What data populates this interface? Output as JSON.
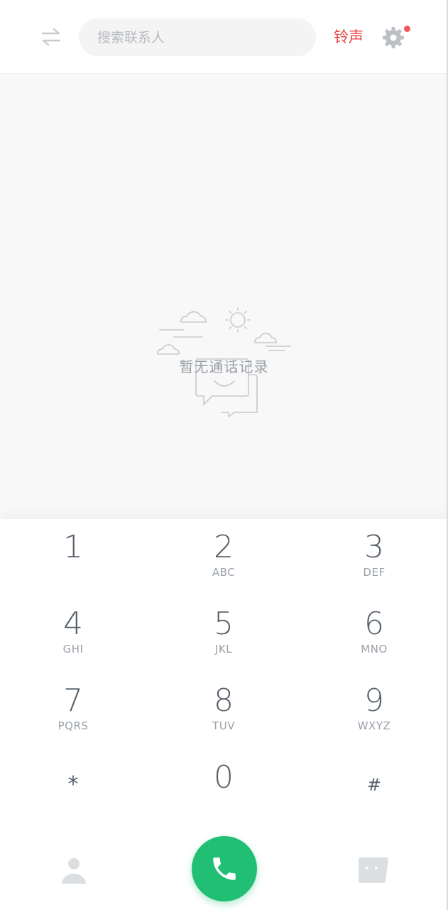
{
  "header": {
    "search_placeholder": "搜索联系人",
    "ringtone_label": "铃声",
    "accent_color": "#e84545"
  },
  "history": {
    "empty_text": "暂无通话记录"
  },
  "dialpad": {
    "keys": [
      {
        "digit": "1",
        "letters": ""
      },
      {
        "digit": "2",
        "letters": "ABC"
      },
      {
        "digit": "3",
        "letters": "DEF"
      },
      {
        "digit": "4",
        "letters": "GHI"
      },
      {
        "digit": "5",
        "letters": "JKL"
      },
      {
        "digit": "6",
        "letters": "MNO"
      },
      {
        "digit": "7",
        "letters": "PQRS"
      },
      {
        "digit": "8",
        "letters": "TUV"
      },
      {
        "digit": "9",
        "letters": "WXYZ"
      },
      {
        "digit": "*",
        "letters": ""
      },
      {
        "digit": "0",
        "letters": ""
      },
      {
        "digit": "#",
        "letters": ""
      }
    ]
  },
  "bottom_bar": {
    "icons": [
      "person-icon",
      "phone-icon",
      "message-icon"
    ],
    "call_color": "#21bf73"
  }
}
